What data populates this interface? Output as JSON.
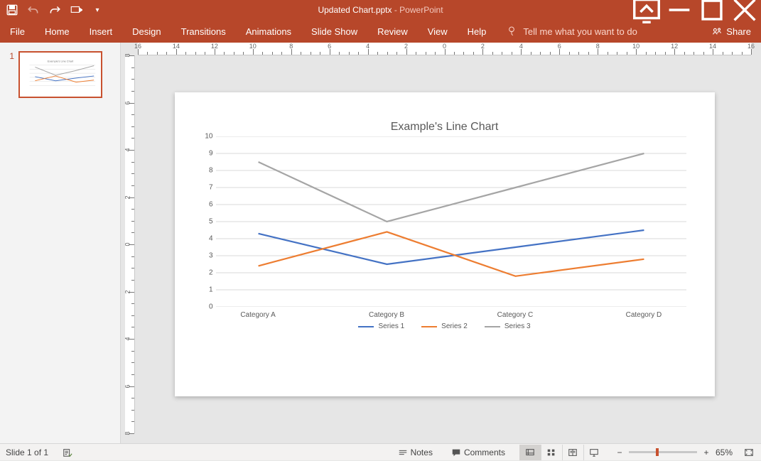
{
  "app": {
    "filename": "Updated Chart.pptx",
    "suffix": " - PowerPoint"
  },
  "ribbon": {
    "file": "File",
    "tabs": [
      "Home",
      "Insert",
      "Design",
      "Transitions",
      "Animations",
      "Slide Show",
      "Review",
      "View",
      "Help"
    ],
    "tellme": "Tell me what you want to do",
    "share": "Share"
  },
  "slidepanel": {
    "slides": [
      {
        "num": "1"
      }
    ]
  },
  "chart_data": {
    "type": "line",
    "title": "Example's Line Chart",
    "categories": [
      "Category A",
      "Category B",
      "Category C",
      "Category D"
    ],
    "series": [
      {
        "name": "Series 1",
        "color": "#4472C4",
        "values": [
          4.3,
          2.5,
          3.5,
          4.5
        ]
      },
      {
        "name": "Series 2",
        "color": "#ED7D31",
        "values": [
          2.4,
          4.4,
          1.8,
          2.8
        ]
      },
      {
        "name": "Series 3",
        "color": "#A5A5A5",
        "values": [
          8.5,
          5.0,
          7.0,
          9.0
        ]
      }
    ],
    "ylim": [
      0,
      10
    ],
    "yticks": [
      0,
      1,
      2,
      3,
      4,
      5,
      6,
      7,
      8,
      9,
      10
    ],
    "xlabel": "",
    "ylabel": ""
  },
  "statusbar": {
    "slideinfo": "Slide 1 of 1",
    "notes": "Notes",
    "comments": "Comments",
    "zoom": "65%"
  },
  "ruler": {
    "h": [
      "16",
      "14",
      "12",
      "10",
      "8",
      "6",
      "4",
      "2",
      "0",
      "2",
      "4",
      "6",
      "8",
      "10",
      "12",
      "14",
      "16"
    ],
    "v": [
      "8",
      "6",
      "4",
      "2",
      "0",
      "2",
      "4",
      "6",
      "8"
    ]
  }
}
